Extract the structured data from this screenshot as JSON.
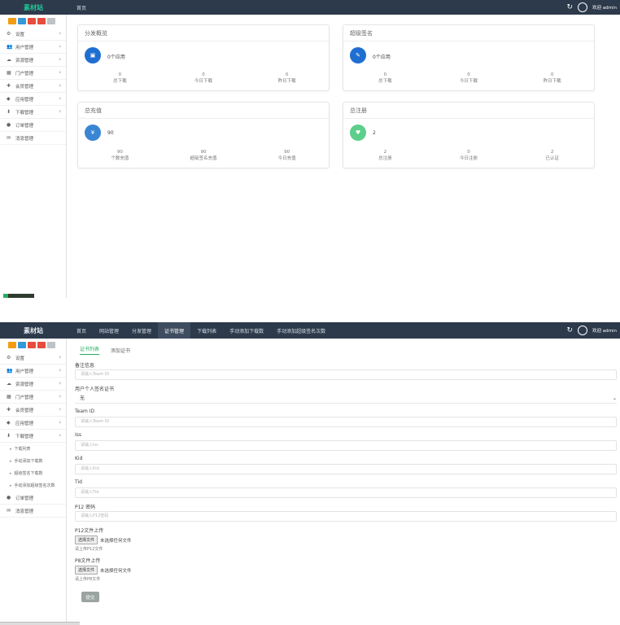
{
  "app": {
    "brand": "素材站"
  },
  "colors": {
    "topbar": "#2d3a4b",
    "accent": "#27ae60",
    "blue": "#1f6fd1",
    "green": "#5ccf8b"
  },
  "chips": [
    "#f39c12",
    "#3498db",
    "#e74c3c",
    "#e74c3c",
    "#bdc3c7"
  ],
  "shot1": {
    "nav": [
      "首页"
    ],
    "user": "欢迎 admin",
    "sidebar": [
      {
        "icon": "gear-icon",
        "glyph": "⚙",
        "label": "设置"
      },
      {
        "icon": "users-icon",
        "glyph": "👥",
        "label": "用户管理"
      },
      {
        "icon": "cloud-icon",
        "glyph": "☁",
        "label": "资源管理"
      },
      {
        "icon": "grid-icon",
        "glyph": "▦",
        "label": "门户管理"
      },
      {
        "icon": "plus-icon",
        "glyph": "✚",
        "label": "会员管理"
      },
      {
        "icon": "diamond-icon",
        "glyph": "◆",
        "label": "应用管理"
      },
      {
        "icon": "download-icon",
        "glyph": "⬇",
        "label": "下载管理"
      },
      {
        "icon": "dot-icon",
        "glyph": "●",
        "label": "订单管理"
      },
      {
        "icon": "message-icon",
        "glyph": "✉",
        "label": "消息管理"
      }
    ],
    "cards": [
      {
        "title": "分发概览",
        "value": "0个应用",
        "glyph": "▣",
        "color": "#1f6fd1",
        "stats": [
          {
            "num": "0",
            "label": "总下载"
          },
          {
            "num": "0",
            "label": "今日下载"
          },
          {
            "num": "0",
            "label": "昨日下载"
          }
        ]
      },
      {
        "title": "超级签名",
        "value": "0个应用",
        "glyph": "✎",
        "color": "#1f6fd1",
        "stats": [
          {
            "num": "0",
            "label": "总下载"
          },
          {
            "num": "0",
            "label": "今日下载"
          },
          {
            "num": "0",
            "label": "昨日下载"
          }
        ]
      },
      {
        "title": "总充值",
        "value": "90",
        "glyph": "¥",
        "color": "#3a86d4",
        "stats": [
          {
            "num": "90",
            "label": "个数充值"
          },
          {
            "num": "90",
            "label": "超级签名充值"
          },
          {
            "num": "90",
            "label": "今日充值"
          }
        ]
      },
      {
        "title": "总注册",
        "value": "2",
        "glyph": "♥",
        "color": "#5ccf8b",
        "stats": [
          {
            "num": "2",
            "label": "总注册"
          },
          {
            "num": "0",
            "label": "今日注册"
          },
          {
            "num": "2",
            "label": "已认证"
          }
        ]
      }
    ]
  },
  "shot2": {
    "nav": [
      {
        "label": "首页",
        "active": false
      },
      {
        "label": "网站管理",
        "active": false
      },
      {
        "label": "分发管理",
        "active": false
      },
      {
        "label": "证书管理",
        "active": true
      },
      {
        "label": "下载列表",
        "active": false
      },
      {
        "label": "手动添加下载数",
        "active": false
      },
      {
        "label": "手动添加超级签名次数",
        "active": false
      }
    ],
    "user": "欢迎 admin",
    "sidebar": [
      {
        "icon": "gear-icon",
        "glyph": "⚙",
        "label": "设置"
      },
      {
        "icon": "users-icon",
        "glyph": "👥",
        "label": "用户管理"
      },
      {
        "icon": "cloud-icon",
        "glyph": "☁",
        "label": "资源管理"
      },
      {
        "icon": "grid-icon",
        "glyph": "▦",
        "label": "门户管理"
      },
      {
        "icon": "plus-icon",
        "glyph": "✚",
        "label": "会员管理"
      },
      {
        "icon": "diamond-icon",
        "glyph": "◆",
        "label": "应用管理"
      },
      {
        "icon": "download-icon",
        "glyph": "⬇",
        "label": "下载管理"
      }
    ],
    "subitems": [
      "下载列表",
      "手动添加下载数",
      "超级签名下载数",
      "手动添加超级签名次数"
    ],
    "sidebar_tail": [
      {
        "icon": "dot-icon",
        "glyph": "●",
        "label": "订单管理"
      },
      {
        "icon": "message-icon",
        "glyph": "✉",
        "label": "消息管理"
      }
    ],
    "tabs": {
      "active": "证书列表",
      "other": "添加证书"
    },
    "form": {
      "remark_label": "备注信息",
      "remark_placeholder": "请输入Team ID",
      "select_label": "用户个人签名证书",
      "select_value": "无",
      "team_label": "Team ID",
      "team_placeholder": "请输入Team ID",
      "iss_label": "Iss",
      "iss_placeholder": "请输入Iss",
      "kid_label": "Kid",
      "kid_placeholder": "请输入Kid",
      "tid_label": "Tid",
      "tid_placeholder": "请输入Tid",
      "p12pw_label": "P12 密码",
      "p12pw_placeholder": "请输入P12密码",
      "p12_label": "P12文件上传",
      "p12_btn": "选择文件",
      "p12_status": "未选择任何文件",
      "p12_hint": "请上传P12文件",
      "p8_label": "P8文件上传",
      "p8_btn": "选择文件",
      "p8_status": "未选择任何文件",
      "p8_hint": "请上传P8文件",
      "submit": "提交"
    }
  }
}
